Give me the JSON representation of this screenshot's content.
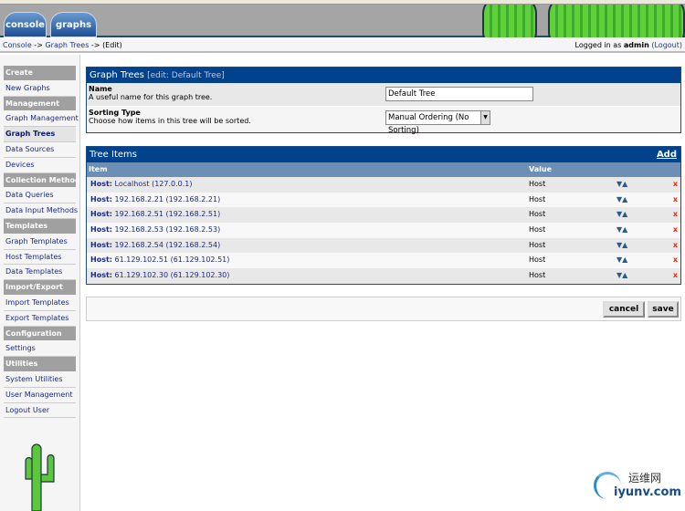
{
  "tabs": [
    {
      "label": "console"
    },
    {
      "label": "graphs"
    }
  ],
  "breadcrumb": {
    "console": "Console",
    "sep1": " -> ",
    "graph_trees": "Graph Trees",
    "sep2": " -> ",
    "edit": "(Edit)"
  },
  "login": {
    "prefix": "Logged in as ",
    "user": "admin",
    "logout": "(Logout)"
  },
  "sidebar": [
    {
      "label": "Create",
      "type": "header"
    },
    {
      "label": "New Graphs"
    },
    {
      "label": "Management",
      "type": "header"
    },
    {
      "label": "Graph Management"
    },
    {
      "label": "Graph Trees",
      "selected": true
    },
    {
      "label": "Data Sources"
    },
    {
      "label": "Devices"
    },
    {
      "label": "Collection Methods",
      "type": "header"
    },
    {
      "label": "Data Queries"
    },
    {
      "label": "Data Input Methods"
    },
    {
      "label": "Templates",
      "type": "header"
    },
    {
      "label": "Graph Templates"
    },
    {
      "label": "Host Templates"
    },
    {
      "label": "Data Templates"
    },
    {
      "label": "Import/Export",
      "type": "header"
    },
    {
      "label": "Import Templates"
    },
    {
      "label": "Export Templates"
    },
    {
      "label": "Configuration",
      "type": "header"
    },
    {
      "label": "Settings"
    },
    {
      "label": "Utilities",
      "type": "header"
    },
    {
      "label": "System Utilities"
    },
    {
      "label": "User Management"
    },
    {
      "label": "Logout User"
    }
  ],
  "form": {
    "title": "Graph Trees",
    "subtitle": "[edit: Default Tree]",
    "name_label": "Name",
    "name_desc": "A useful name for this graph tree.",
    "name_value": "Default Tree",
    "sort_label": "Sorting Type",
    "sort_desc": "Choose how items in this tree will be sorted.",
    "sort_value": "Manual Ordering (No Sorting)"
  },
  "tree": {
    "title": "Tree Items",
    "add": "Add",
    "col_item": "Item",
    "col_value": "Value",
    "rows": [
      {
        "prefix": "Host:",
        "name": " Localhost (127.0.0.1)",
        "value": "Host"
      },
      {
        "prefix": "Host:",
        "name": " 192.168.2.21 (192.168.2.21)",
        "value": "Host"
      },
      {
        "prefix": "Host:",
        "name": " 192.168.2.51 (192.168.2.51)",
        "value": "Host"
      },
      {
        "prefix": "Host:",
        "name": " 192.168.2.53 (192.168.2.53)",
        "value": "Host"
      },
      {
        "prefix": "Host:",
        "name": " 192.168.2.54 (192.168.2.54)",
        "value": "Host"
      },
      {
        "prefix": "Host:",
        "name": " 61.129.102.51 (61.129.102.51)",
        "value": "Host"
      },
      {
        "prefix": "Host:",
        "name": " 61.129.102.30 (61.129.102.30)",
        "value": "Host"
      }
    ]
  },
  "buttons": {
    "cancel": "cancel",
    "save": "save"
  },
  "watermark": {
    "cn": "运维网",
    "en": "iyunv.com"
  },
  "colors": {
    "header_blue": "#00438c",
    "column_header": "#6d8fb5",
    "delete": "#e03010"
  }
}
